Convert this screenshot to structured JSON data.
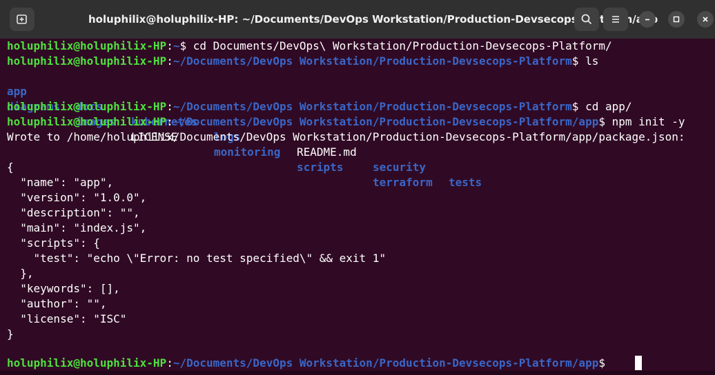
{
  "window": {
    "title": "holuphilix@holuphilix-HP: ~/Documents/DevOps Workstation/Production-Devsecops-Platform/app"
  },
  "icons": {
    "new_tab": "new-tab-icon",
    "search": "search-icon",
    "menu": "hamburger-menu-icon",
    "minimize": "minimize-icon",
    "maximize": "maximize-icon",
    "close": "close-icon"
  },
  "colors": {
    "background": "#300a24",
    "user_host": "#4fe03f",
    "path": "#3a66c8",
    "titlebar": "#303030"
  },
  "prompt": {
    "user": "holuphilix@holuphilix-HP",
    "sep": ":",
    "home_path": "~",
    "project_path": "~/Documents/DevOps Workstation/Production-Devsecops-Platform",
    "app_path": "~/Documents/DevOps Workstation/Production-Devsecops-Platform/app",
    "dollar": "$ "
  },
  "commands": {
    "cd1": "cd Documents/DevOps\\ Workstation/Production-Devsecops-Platform/",
    "ls": "ls",
    "cd2": "cd app/",
    "npm": "npm init -y"
  },
  "ls_output": {
    "row1": [
      {
        "name": "app",
        "type": "dir"
      },
      {
        "name": "docs",
        "type": "dir"
      },
      {
        "name": "kubernetes",
        "type": "dir"
      },
      {
        "name": "logs",
        "type": "dir"
      },
      {
        "name": "README.md",
        "type": "file"
      },
      {
        "name": "security",
        "type": "dir"
      },
      {
        "name": "tests",
        "type": "dir"
      }
    ],
    "row2": [
      {
        "name": "diagrams",
        "type": "dir"
      },
      {
        "name": "images",
        "type": "dir"
      },
      {
        "name": "LICENSE",
        "type": "file"
      },
      {
        "name": "monitoring",
        "type": "dir"
      },
      {
        "name": "scripts",
        "type": "dir"
      },
      {
        "name": "terraform",
        "type": "dir"
      }
    ]
  },
  "output": {
    "wrote": "Wrote to /home/holuphilix/Documents/DevOps Workstation/Production-Devsecops-Platform/app/package.json:",
    "json_lines": [
      "{",
      "  \"name\": \"app\",",
      "  \"version\": \"1.0.0\",",
      "  \"description\": \"\",",
      "  \"main\": \"index.js\",",
      "  \"scripts\": {",
      "    \"test\": \"echo \\\"Error: no test specified\\\" && exit 1\"",
      "  },",
      "  \"keywords\": [],",
      "  \"author\": \"\",",
      "  \"license\": \"ISC\"",
      "}"
    ]
  }
}
